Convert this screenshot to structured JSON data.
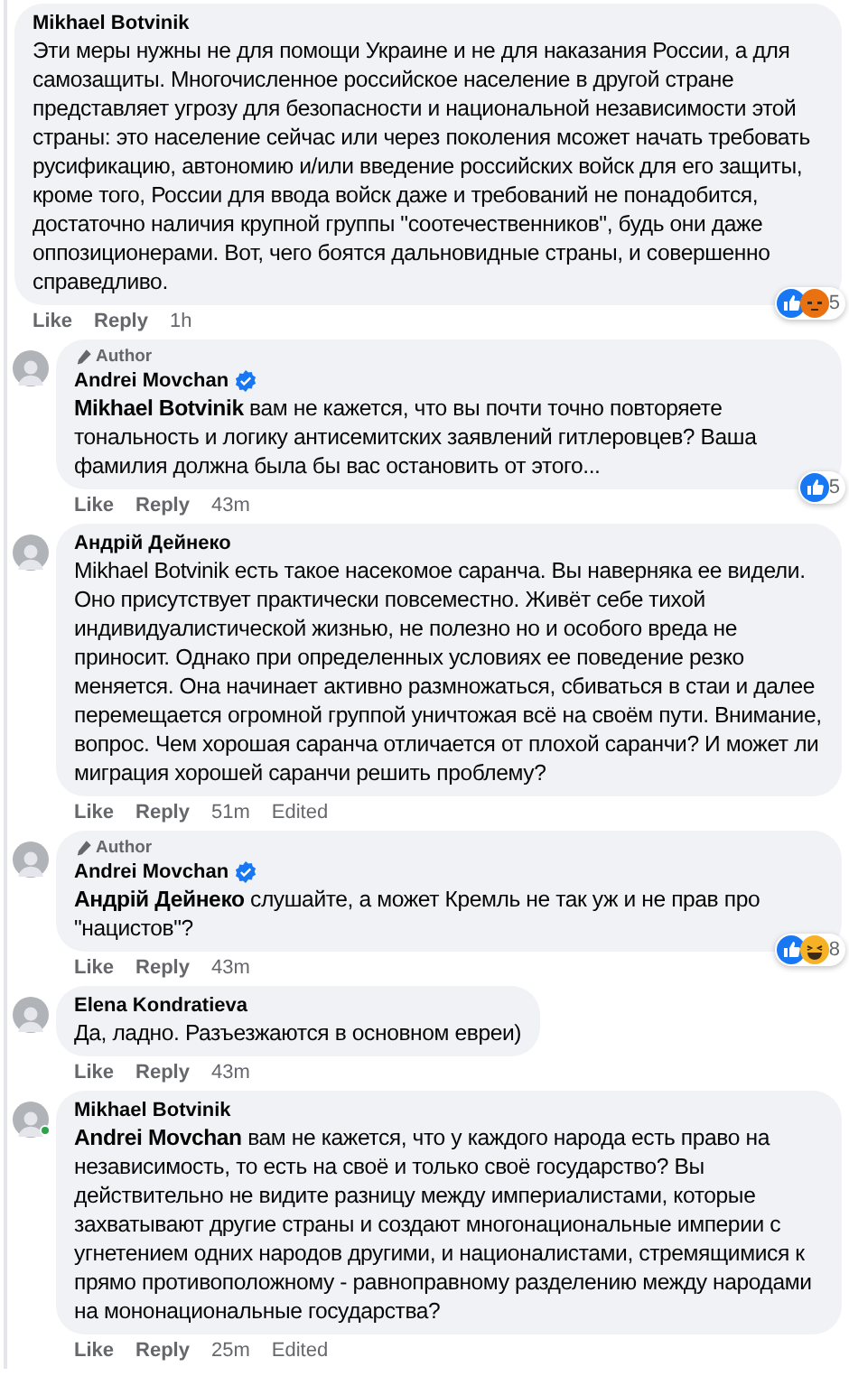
{
  "comments": [
    {
      "author": "Mikhael Botvinik",
      "text": "Эти меры нужны не для помощи Украине и не для наказания России, а для самозащиты. Многочисленное российское население в другой стране представляет угрозу для безопасности и национальной независимости этой страны: это население сейчас или через поколения мсожет начать требовать русификацию, автономию и/или введение российских войск для его защиты, кроме того, России для ввода войск даже и требований не понадобится, достаточно наличия крупной группы \"соотечественников\", будь они даже оппозиционерами. Вот, чего боятся дальновидные страны, и совершенно справедливо.",
      "reactions": [
        {
          "kind": "like"
        },
        {
          "kind": "angry"
        }
      ],
      "reaction_count": "5",
      "actions": [
        "Like",
        "Reply"
      ],
      "time": "1h"
    },
    {
      "author": "Andrei Movchan",
      "avatar": true,
      "author_badge": "Author",
      "verified": true,
      "text": "**Mikhael Botvinik** вам не кажется, что вы почти точно повторяете тональность и логику антисемитских заявлений гитлеровцев? Ваша фамилия должна была бы вас остановить от этого...",
      "reactions": [
        {
          "kind": "like"
        }
      ],
      "reaction_count": "5",
      "actions": [
        "Like",
        "Reply"
      ],
      "time": "43m"
    },
    {
      "author": "Андрій Дейнеко",
      "avatar": true,
      "text": "Mikhael Botvinik есть такое насекомое саранча. Вы наверняка ее видели. Оно присутствует практически повсеместно. Живёт себе тихой индивидуалистической жизнью, не полезно но и особого вреда не приносит. Однако при определенных условиях ее поведение резко меняется. Она начинает активно размножаться, сбиваться в стаи и далее перемещается огромной группой уничтожая всё на своём пути. Внимание, вопрос. Чем хорошая саранча отличается от плохой саранчи? И может ли миграция хорошей саранчи решить проблему?",
      "actions": [
        "Like",
        "Reply"
      ],
      "time": "51m",
      "edited": "Edited"
    },
    {
      "author": "Andrei Movchan",
      "avatar": true,
      "author_badge": "Author",
      "verified": true,
      "text": "**Андрій Дейнеко** слушайте, а может Кремль не так уж и не прав про \"нацистов\"?",
      "reactions": [
        {
          "kind": "like"
        },
        {
          "kind": "haha"
        }
      ],
      "reaction_count": "8",
      "actions": [
        "Like",
        "Reply"
      ],
      "time": "43m"
    },
    {
      "author": "Elena Kondratieva",
      "avatar": true,
      "text": "Да, ладно. Разъезжаются в основном евреи)",
      "actions": [
        "Like",
        "Reply"
      ],
      "time": "43m"
    },
    {
      "author": "Mikhael Botvinik",
      "avatar": true,
      "online": true,
      "text": "**Andrei Movchan** вам не кажется, что у каждого народа есть право на независимость, то есть на своё и только своё государство? Вы действительно не видите разницу между империалистами, которые захватывают другие страны и создают многонациональные империи с угнетением одних народов другими, и националистами, стремящимися к прямо противоположному - равноправному разделению между народами на мононациональные государства?",
      "actions": [
        "Like",
        "Reply"
      ],
      "time": "25m",
      "edited": "Edited"
    }
  ]
}
